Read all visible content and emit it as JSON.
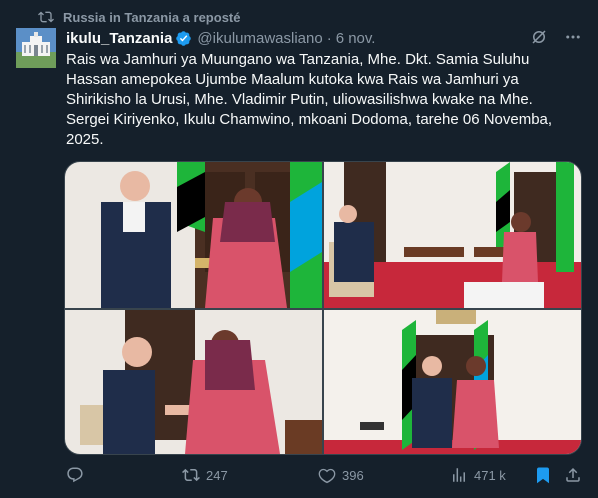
{
  "repost": {
    "icon": "repost-icon",
    "text": "Russia in Tanzania a reposté"
  },
  "author": {
    "display_name": "ikulu_Tanzania",
    "handle": "@ikulumawasliano",
    "separator": "·",
    "time": "6 nov.",
    "verified_color": "#1d9bf0"
  },
  "post": {
    "text": "Rais wa Jamhuri ya Muungano wa Tanzania, Mhe. Dkt. Samia Suluhu Hassan amepokea Ujumbe Maalum kutoka kwa Rais wa Jamhuri ya Shirikisho la Urusi, Mhe. Vladimir Putin, uliowasilishwa kwake na Mhe. Sergei Kiriyenko, Ikulu Chamwino, mkoani Dodoma, tarehe 06 Novemba, 2025."
  },
  "media": {
    "photo_count": 4
  },
  "actions": {
    "reply_count": "",
    "repost_count": "247",
    "like_count": "396",
    "views_count": "471 k",
    "bookmark_active_color": "#1d9bf0"
  },
  "colors": {
    "background": "#15202b",
    "muted": "#8b98a5",
    "text": "#f7f9f9",
    "accent": "#1d9bf0"
  }
}
